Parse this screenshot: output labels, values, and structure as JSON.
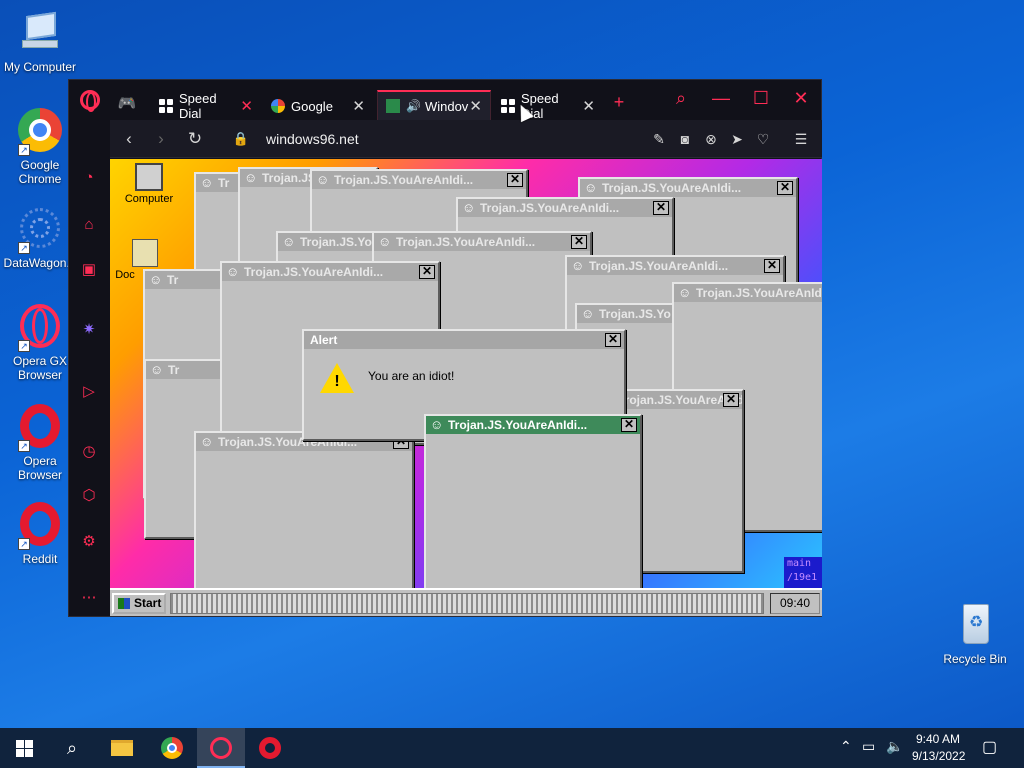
{
  "desktop": {
    "icons": [
      {
        "label": "My Computer"
      },
      {
        "label": "Google Chrome"
      },
      {
        "label": "DataWagon..."
      },
      {
        "label": "Opera GX Browser"
      },
      {
        "label": "Opera Browser"
      },
      {
        "label": "Reddit"
      },
      {
        "label": "Recycle Bin"
      }
    ]
  },
  "browser": {
    "tabs": [
      {
        "label": "Speed Dial",
        "icon": "speed-dial-icon"
      },
      {
        "label": "Google",
        "icon": "google-icon"
      },
      {
        "label": "Windov",
        "icon": "windows96-icon"
      },
      {
        "label": "Speed Dial",
        "icon": "speed-dial-icon"
      }
    ],
    "url": "windows96.net",
    "accent": "#ff2d55"
  },
  "w96": {
    "desktop_icons": [
      {
        "label": "Computer"
      },
      {
        "label": "Doc"
      }
    ],
    "window_title": "Trojan.JS.YouAreAnIdi...",
    "active_title": "Trojan.JS.YouAreAnIdi...",
    "short_title": "Trojan.JS.Yo",
    "tiny_title": "Tr",
    "alert": {
      "title": "Alert",
      "message": "You are an idiot!"
    },
    "start_label": "Start",
    "clock": "09:40",
    "corner_text_1": "main",
    "corner_text_2": "/19e1"
  },
  "taskbar": {
    "time": "9:40 AM",
    "date": "9/13/2022"
  }
}
